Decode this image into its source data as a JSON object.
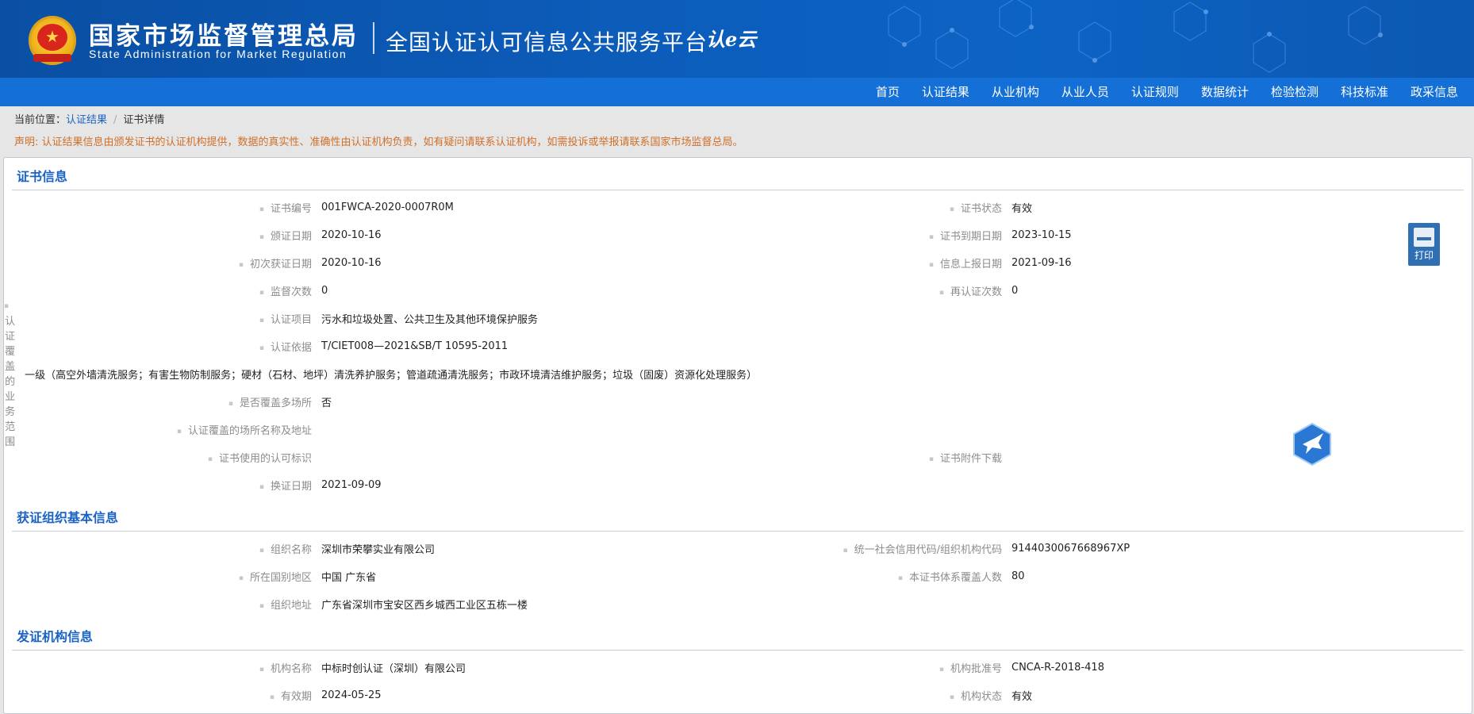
{
  "header": {
    "org_cn": "国家市场监督管理总局",
    "org_en": "State Administration  for  Market Regulation",
    "platform": "全国认证认可信息公共服务平台",
    "platform_logo": "认e云"
  },
  "nav": [
    "首页",
    "认证结果",
    "从业机构",
    "从业人员",
    "认证规则",
    "数据统计",
    "检验检测",
    "科技标准",
    "政采信息"
  ],
  "breadcrumb": {
    "prefix": "当前位置：",
    "link": "认证结果",
    "sep": "/",
    "current": "证书详情"
  },
  "notice": "声明: 认证结果信息由颁发证书的认证机构提供，数据的真实性、准确性由认证机构负责，如有疑问请联系认证机构，如需投诉或举报请联系国家市场监督总局。",
  "print_label": "打印",
  "sections": {
    "cert": {
      "title": "证书信息",
      "rows": [
        [
          {
            "label": "证书编号",
            "value": "001FWCA-2020-0007R0M"
          },
          {
            "label": "证书状态",
            "value": "有效"
          }
        ],
        [
          {
            "label": "颁证日期",
            "value": "2020-10-16"
          },
          {
            "label": "证书到期日期",
            "value": "2023-10-15"
          }
        ],
        [
          {
            "label": "初次获证日期",
            "value": "2020-10-16"
          },
          {
            "label": "信息上报日期",
            "value": "2021-09-16"
          }
        ],
        [
          {
            "label": "监督次数",
            "value": "0"
          },
          {
            "label": "再认证次数",
            "value": "0"
          }
        ],
        [
          {
            "label": "认证项目",
            "value": "污水和垃圾处置、公共卫生及其他环境保护服务"
          }
        ],
        [
          {
            "label": "认证依据",
            "value": "T/CIET008—2021&SB/T 10595-2011"
          }
        ],
        [
          {
            "label": "认证覆盖的业务范围",
            "value": "一级（高空外墙清洗服务；有害生物防制服务；硬材（石材、地坪）清洗养护服务；管道疏通清洗服务；市政环境清洁维护服务；垃圾（固废）资源化处理服务）"
          }
        ],
        [
          {
            "label": "是否覆盖多场所",
            "value": "否"
          }
        ],
        [
          {
            "label": "认证覆盖的场所名称及地址",
            "value": ""
          }
        ],
        [
          {
            "label": "证书使用的认可标识",
            "value": ""
          },
          {
            "label": "证书附件下载",
            "value": ""
          }
        ],
        [
          {
            "label": "换证日期",
            "value": "2021-09-09"
          }
        ]
      ]
    },
    "org": {
      "title": "获证组织基本信息",
      "rows": [
        [
          {
            "label": "组织名称",
            "value": "深圳市荣攀实业有限公司"
          },
          {
            "label": "统一社会信用代码/组织机构代码",
            "value": "9144030067668967XP"
          }
        ],
        [
          {
            "label": "所在国别地区",
            "value": "中国 广东省"
          },
          {
            "label": "本证书体系覆盖人数",
            "value": "80"
          }
        ],
        [
          {
            "label": "组织地址",
            "value": "广东省深圳市宝安区西乡城西工业区五栋一楼"
          }
        ]
      ]
    },
    "issuer": {
      "title": "发证机构信息",
      "rows": [
        [
          {
            "label": "机构名称",
            "value": "中标时创认证（深圳）有限公司"
          },
          {
            "label": "机构批准号",
            "value": "CNCA-R-2018-418"
          }
        ],
        [
          {
            "label": "有效期",
            "value": "2024-05-25"
          },
          {
            "label": "机构状态",
            "value": "有效"
          }
        ]
      ]
    }
  }
}
